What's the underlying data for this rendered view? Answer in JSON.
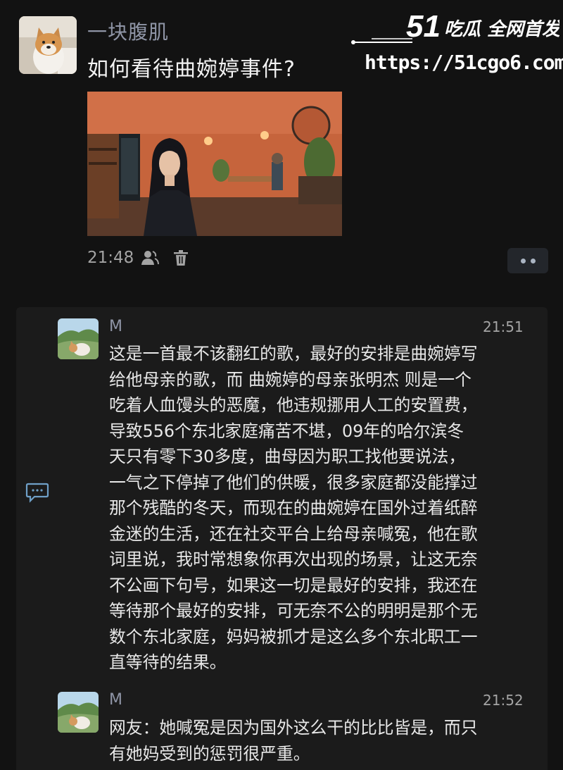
{
  "watermark": {
    "brand_number": "51",
    "brand_text": "吃瓜 全网首发",
    "url": "https://51cgo6.com"
  },
  "post": {
    "author": "一块腹肌",
    "title": "如何看待曲婉婷事件?",
    "time": "21:48",
    "icons": [
      "person-icon",
      "trash-icon"
    ],
    "more_icon": "more-dots-icon"
  },
  "comments": [
    {
      "name": "M",
      "time": "21:51",
      "lines": [
        "这是一首最不该翻红的歌，最好的安排是曲婉婷写",
        "给他母亲的歌，而 曲婉婷的母亲张明杰 则是一个",
        "吃着人血馒头的恶魔，他违规挪用人工的安置费，",
        "导致556个东北家庭痛苦不堪，09年的哈尔滨冬",
        "天只有零下30多度，曲母因为职工找他要说法，",
        "一气之下停掉了他们的供暖，很多家庭都没能撑过",
        "那个残酷的冬天，而现在的曲婉婷在国外过着纸醉",
        "金迷的生活，还在社交平台上给母亲喊冤，他在歌",
        "词里说，我时常想象你再次出现的场景，让这无奈",
        "不公画下句号，如果这一切是最好的安排，我还在",
        "等待那个最好的安排，可无奈不公的明明是那个无",
        "数个东北家庭，妈妈被抓才是这么多个东北职工一",
        "直等待的结果。"
      ]
    },
    {
      "name": "M",
      "time": "21:52",
      "lines": [
        "网友：她喊冤是因为国外这么干的比比皆是，而只",
        "有她妈受到的惩罚很严重。"
      ]
    }
  ],
  "side_icon": "comment-icon"
}
